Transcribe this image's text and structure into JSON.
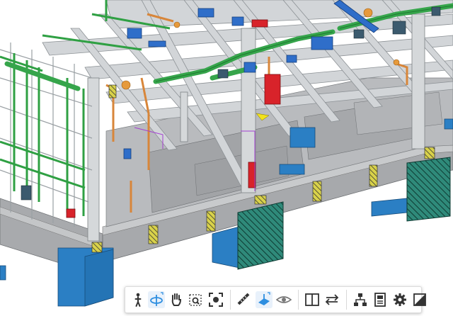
{
  "app": {
    "view": "3d-model-viewer",
    "colors": {
      "steel": "#c9ccd0",
      "steel_dark": "#8d9296",
      "concrete": "#a9abae",
      "pipe_green": "#35a24a",
      "duct_blue": "#2f6ec9",
      "footing_blue": "#2b7fc4",
      "hatch_green": "#2f8a7a",
      "accent_red": "#d8232a",
      "pipe_orange": "#d8863a",
      "toolbar_icon": "#333333",
      "toolbar_active": "#2d8ee0"
    }
  },
  "toolbar": {
    "buttons": [
      {
        "icon": "person-walk-icon",
        "active": false
      },
      {
        "icon": "orbit-icon",
        "active": true
      },
      {
        "icon": "pan-hand-icon",
        "active": false
      },
      {
        "icon": "zoom-window-icon",
        "active": false
      },
      {
        "icon": "fit-to-view-icon",
        "active": false
      },
      {
        "icon": "measure-ruler-icon",
        "active": false
      },
      {
        "icon": "section-plane-icon",
        "active": true
      },
      {
        "icon": "explode-view-icon",
        "active": false
      },
      {
        "icon": "split-view-icon",
        "active": false
      },
      {
        "icon": "swap-arrows-icon",
        "active": false
      },
      {
        "icon": "model-tree-icon",
        "active": false
      },
      {
        "icon": "properties-icon",
        "active": false
      },
      {
        "icon": "settings-gear-icon",
        "active": false
      },
      {
        "icon": "fullscreen-icon",
        "active": false
      }
    ]
  }
}
